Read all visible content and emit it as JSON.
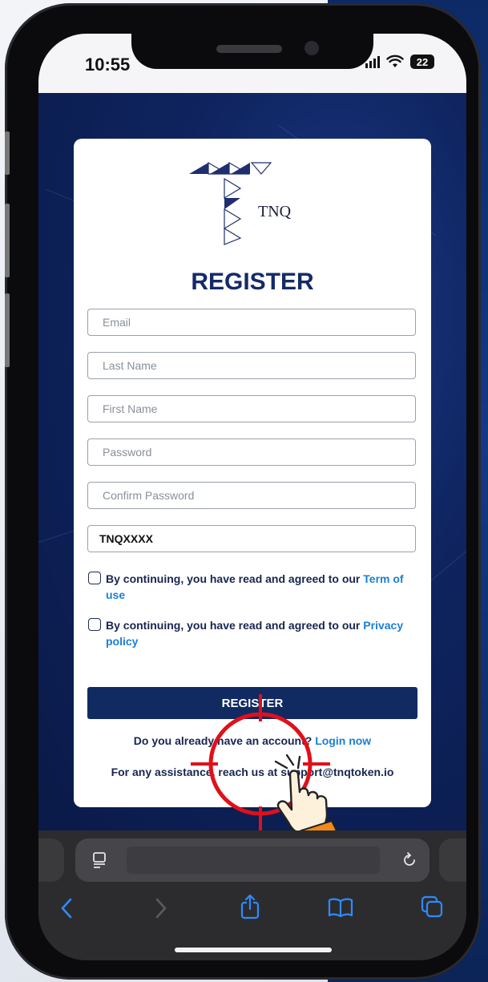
{
  "status": {
    "time": "10:55",
    "battery": "22"
  },
  "brand": {
    "logo_text": "TNQ"
  },
  "form": {
    "title": "REGISTER",
    "email_placeholder": "Email",
    "last_name_placeholder": "Last Name",
    "first_name_placeholder": "First Name",
    "password_placeholder": "Password",
    "confirm_password_placeholder": "Confirm Password",
    "referral_value": "TNQXXXX",
    "terms_text": "By continuing, you have read and agreed to our ",
    "terms_link": "Term of use",
    "privacy_text": "By continuing, you have read and agreed to our ",
    "privacy_link": "Privacy policy",
    "submit_label": "REGISTER",
    "login_prompt": "Do you already have an account? ",
    "login_link": "Login now",
    "support_text": "For any assistance, reach us at support@tnqtoken.io"
  },
  "colors": {
    "brand_navy": "#112a62",
    "link_blue": "#1a7fd6",
    "target_red": "#e0101a"
  },
  "icons": {
    "status": [
      "signal-icon",
      "wifi-icon",
      "battery-icon"
    ],
    "toolbar": [
      "reader-icon",
      "reload-icon",
      "back-icon",
      "forward-icon",
      "share-icon",
      "bookmarks-icon",
      "tabs-icon"
    ],
    "overlay": [
      "target-crosshair-icon",
      "hand-pointer-icon"
    ]
  }
}
